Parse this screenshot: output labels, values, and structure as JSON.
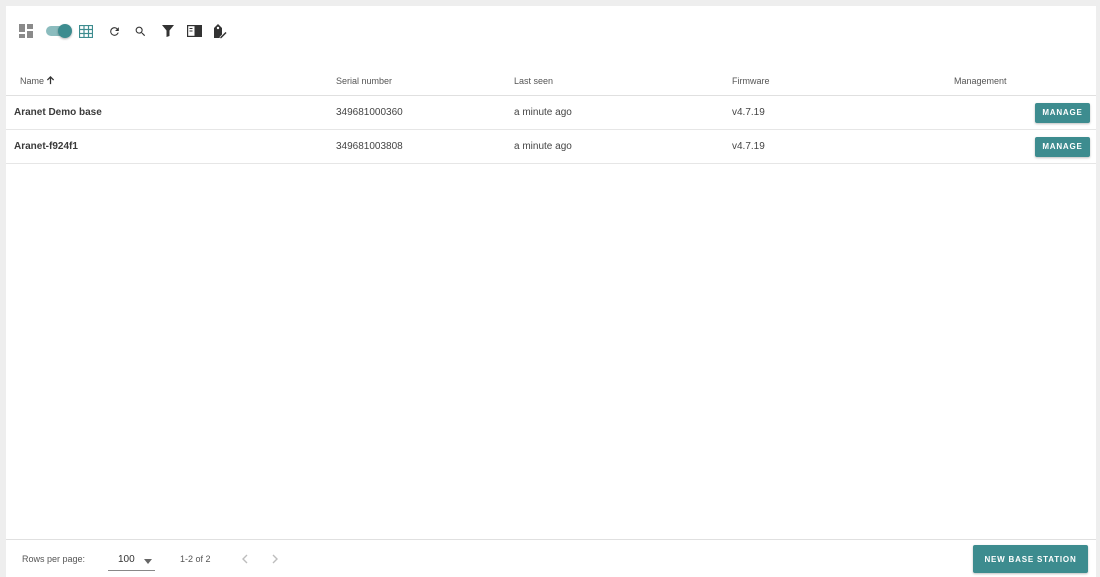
{
  "toolbar": {
    "icons": [
      "grid-view-icon",
      "view-toggle",
      "table-view-icon",
      "refresh-icon",
      "search-icon",
      "filter-icon",
      "columns-icon",
      "tag-edit-icon"
    ],
    "toggle_on": true
  },
  "table": {
    "columns": {
      "name": "Name",
      "serial": "Serial number",
      "last_seen": "Last seen",
      "firmware": "Firmware",
      "management": "Management"
    },
    "sort": {
      "column": "name",
      "direction": "ascending"
    },
    "rows": [
      {
        "name": "Aranet Demo base",
        "serial": "349681000360",
        "last_seen": "a minute ago",
        "firmware": "v4.7.19",
        "action": "MANAGE"
      },
      {
        "name": "Aranet-f924f1",
        "serial": "349681003808",
        "last_seen": "a minute ago",
        "firmware": "v4.7.19",
        "action": "MANAGE"
      }
    ]
  },
  "footer": {
    "rows_per_page_label": "Rows per page:",
    "rows_per_page_value": "100",
    "page_info": "1-2 of 2",
    "new_button": "NEW BASE STATION"
  },
  "colors": {
    "accent": "#3d8c8f",
    "toggle_track": "#8bbcbe",
    "background": "#eeeeee",
    "panel": "#ffffff"
  }
}
